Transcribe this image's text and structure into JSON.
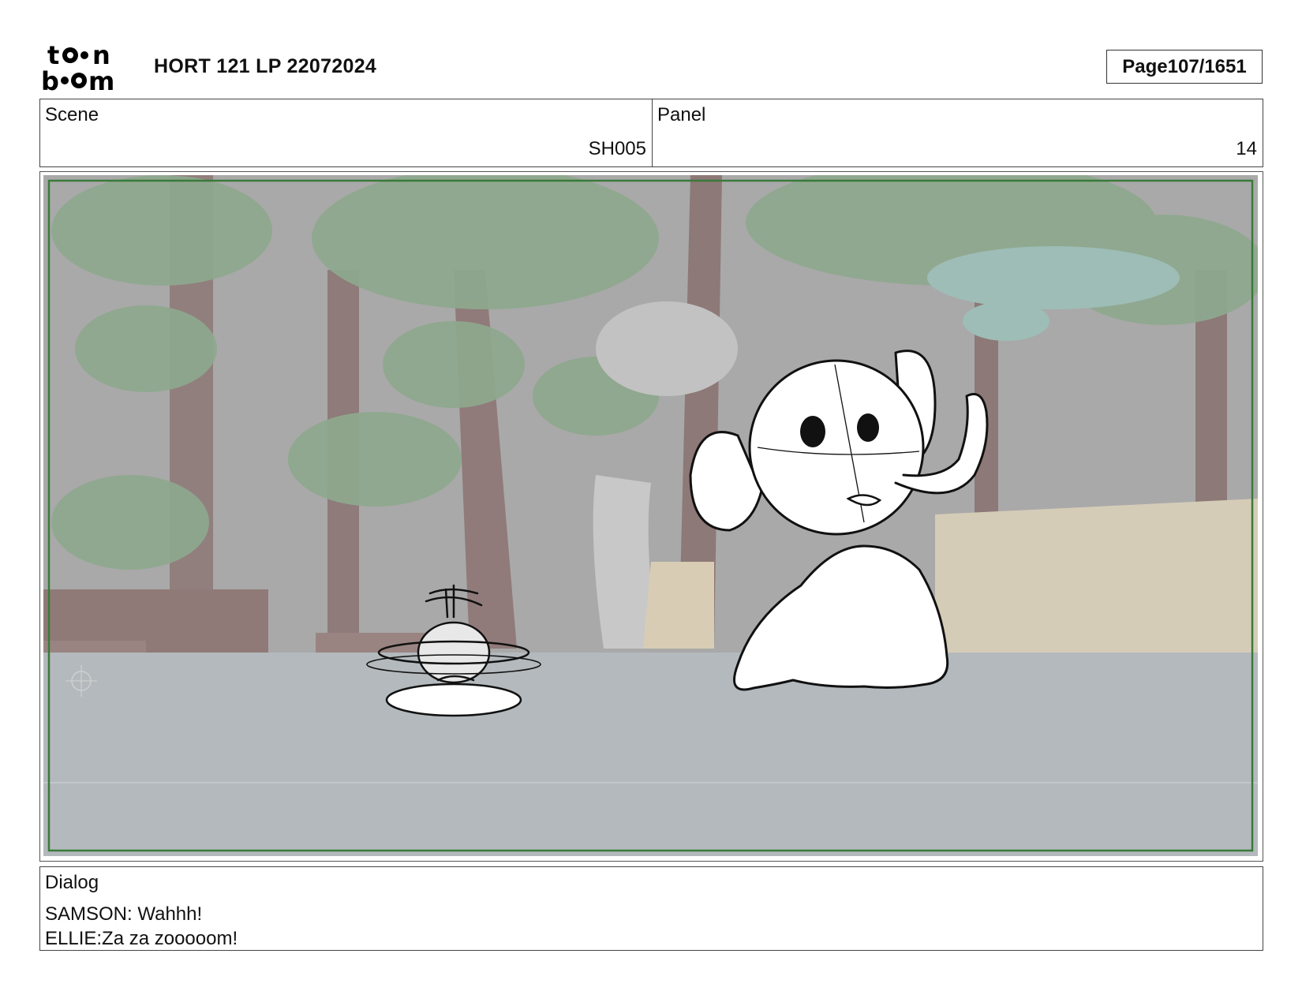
{
  "header": {
    "logo_text": "toon boom",
    "title": "HORT 121 LP 22072024",
    "page_label": "Page",
    "page_number": "107/1651"
  },
  "scene": {
    "label": "Scene",
    "value": "SH005"
  },
  "panel": {
    "label": "Panel",
    "value": "14"
  },
  "panel_image": {
    "description_icon": "storyboard-sketch-image",
    "safe_frame_color": "#3a7a3a"
  },
  "dialog": {
    "label": "Dialog",
    "lines": [
      "SAMSON: Wahhh!",
      "ELLIE:Za za zooooom!"
    ]
  }
}
